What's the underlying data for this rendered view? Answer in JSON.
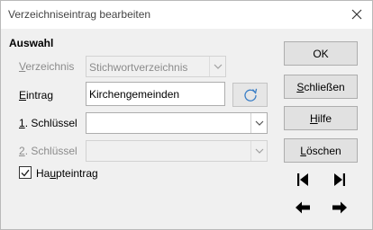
{
  "window": {
    "title": "Verzeichniseintrag bearbeiten"
  },
  "section": {
    "title": "Auswahl"
  },
  "fields": {
    "verzeichnis": {
      "label_u": "V",
      "label_rest": "erzeichnis",
      "value": "Stichwortverzeichnis",
      "enabled": false
    },
    "eintrag": {
      "label_u": "E",
      "label_rest": "intrag",
      "value": "Kirchengemeinden"
    },
    "schluessel1": {
      "label_u": "1",
      "label_rest": ". Schlüssel",
      "value": ""
    },
    "schluessel2": {
      "label_u": "2",
      "label_rest": ". Schlüssel",
      "value": "",
      "enabled": false
    }
  },
  "haupteintrag": {
    "label_pre": "Ha",
    "label_u": "u",
    "label_rest": "pteintrag",
    "checked": true
  },
  "buttons": {
    "ok": {
      "label": "OK"
    },
    "schliessen": {
      "label_u": "S",
      "label_rest": "chließen"
    },
    "hilfe": {
      "label_u": "H",
      "label_rest": "ilfe"
    },
    "loeschen": {
      "label_u": "L",
      "label_rest": "öschen"
    }
  },
  "colors": {
    "border": "#adadad",
    "dialog_bg": "#f0f0f0",
    "disabled_text": "#8c8c8c",
    "refresh_icon": "#3a7ec6"
  }
}
